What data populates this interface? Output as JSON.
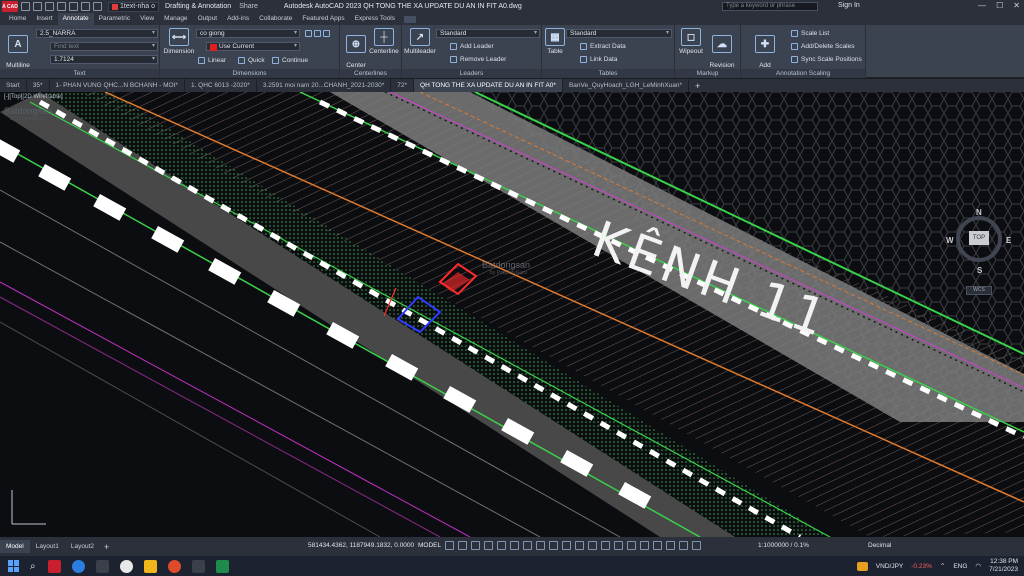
{
  "titlebar": {
    "app_logo": "A CAD",
    "open_file_chip": "1text-nha o",
    "workspace": "Drafting & Annotation",
    "share": "Share",
    "document_title": "Autodesk AutoCAD 2023   QH TONG THE XA UPDATE DU AN IN FIT A0.dwg",
    "search_placeholder": "Type a keyword or phrase",
    "sign_in": "Sign In",
    "window_controls": [
      "—",
      "☐",
      "✕"
    ]
  },
  "ribbon_tabs": [
    "Home",
    "Insert",
    "Annotate",
    "Parametric",
    "View",
    "Manage",
    "Output",
    "Add-ins",
    "Collaborate",
    "Featured Apps",
    "Express Tools"
  ],
  "active_ribbon_tab": "Annotate",
  "ribbon": {
    "text_panel": {
      "title": "Text",
      "multiline_text": "Multiline\nText",
      "text_style": "2.5_NARRA",
      "find_text_placeholder": "Find text",
      "text_height": "1.7124"
    },
    "dimensions_panel": {
      "title": "Dimensions",
      "dimension": "Dimension",
      "dim_style": "co giong",
      "layer": "Use Current",
      "linear": "Linear",
      "quick": "Quick",
      "continue": "Continue"
    },
    "centerlines_panel": {
      "title": "Centerlines",
      "center_mark": "Center\nMark",
      "centerline": "Centerline"
    },
    "leaders_panel": {
      "title": "Leaders",
      "multileader": "Multileader",
      "style": "Standard",
      "add_leader": "Add Leader",
      "remove_leader": "Remove Leader"
    },
    "tables_panel": {
      "title": "Tables",
      "table": "Table",
      "style": "Standard",
      "extract_data": "Extract Data",
      "link_data": "Link Data"
    },
    "markup_panel": {
      "title": "Markup",
      "wipeout": "Wipeout",
      "revision_cloud": "Revision\nCloud"
    },
    "annotation_scaling_panel": {
      "title": "Annotation Scaling",
      "add_current_scale": "Add\nCurrent Scale",
      "scale_list": "Scale List",
      "add_delete_scales": "Add/Delete Scales",
      "sync_scale_positions": "Sync Scale Positions"
    }
  },
  "file_tabs": [
    "Start",
    "35*",
    "1- PHAN VUNG QHC...N BCHANH - MOI*",
    "1. QHC 6013 -2020*",
    "3.2591 moi nam 20...CHANH_2021-2030*",
    "72*",
    "QH TONG THE XA UPDATE DU AN IN FIT A0*",
    "BanVe_QuyHoach_LGH_LeMinhXuan*"
  ],
  "active_file_tab": 6,
  "drawing": {
    "viewport_label": "[-][Top][2D Wireframe]",
    "canal_label": "KÊNH 11",
    "watermark": "Batdongsan",
    "watermark_sub": "by PropertyGuru",
    "viewcube": {
      "north": "N",
      "south": "S",
      "east": "E",
      "west": "W",
      "top": "TOP",
      "wcs": "WCS"
    },
    "colors": {
      "background": "#0c0d10",
      "road_gray": "#8c8c8c",
      "green_edge": "#39d14a",
      "orange_line": "#e07a2c",
      "magenta_line": "#d040d0",
      "hatch": "#6e5a55",
      "dash_white": "#ffffff",
      "marker_red": "#ff2a2a",
      "marker_blue": "#2f3cff"
    }
  },
  "status": {
    "layout_tabs": [
      "Model",
      "Layout1",
      "Layout2"
    ],
    "coordinates": "581434.4362, 1187949.1832, 0.0000",
    "model": "MODEL",
    "annotation_scale": "1:1000000 / 0.1%",
    "units": "Decimal"
  },
  "taskbar": {
    "currency": "VND/JPY",
    "change": "-0.23%",
    "language": "ENG",
    "time": "12:38 PM",
    "date": "7/21/2023"
  }
}
